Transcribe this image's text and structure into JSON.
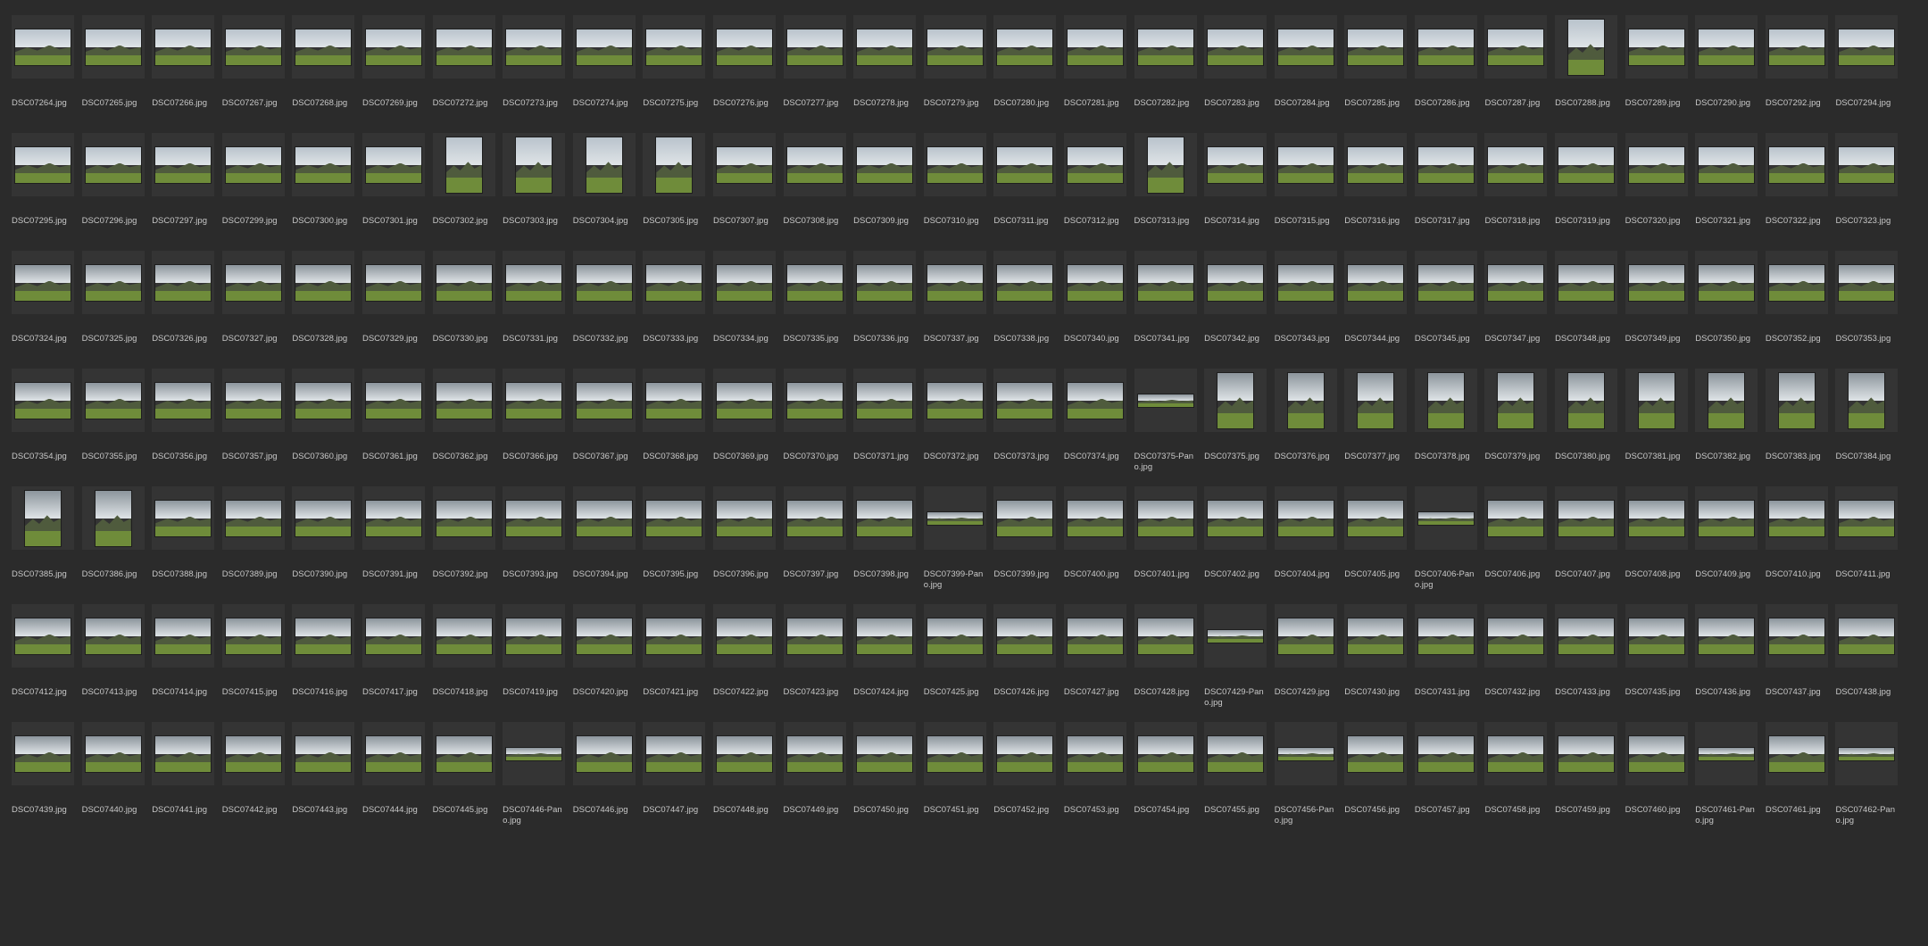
{
  "rows": [
    [
      "DSC07264.jpg",
      "DSC07265.jpg",
      "DSC07266.jpg",
      "DSC07267.jpg",
      "DSC07268.jpg",
      "DSC07269.jpg",
      "DSC07272.jpg",
      "DSC07273.jpg",
      "DSC07274.jpg",
      "DSC07275.jpg",
      "DSC07276.jpg",
      "DSC07277.jpg",
      "DSC07278.jpg",
      "DSC07279.jpg",
      "DSC07280.jpg",
      "DSC07281.jpg",
      "DSC07282.jpg",
      "DSC07283.jpg",
      "DSC07284.jpg",
      "DSC07285.jpg",
      "DSC07286.jpg",
      "DSC07287.jpg",
      "DSC07288.jpg",
      "DSC07289.jpg",
      "DSC07290.jpg",
      "DSC07292.jpg",
      "DSC07294.jpg"
    ],
    [
      "DSC07295.jpg",
      "DSC07296.jpg",
      "DSC07297.jpg",
      "DSC07299.jpg",
      "DSC07300.jpg",
      "DSC07301.jpg",
      "DSC07302.jpg",
      "DSC07303.jpg",
      "DSC07304.jpg",
      "DSC07305.jpg",
      "DSC07307.jpg",
      "DSC07308.jpg",
      "DSC07309.jpg",
      "DSC07310.jpg",
      "DSC07311.jpg",
      "DSC07312.jpg",
      "DSC07313.jpg",
      "DSC07314.jpg",
      "DSC07315.jpg",
      "DSC07316.jpg",
      "DSC07317.jpg",
      "DSC07318.jpg",
      "DSC07319.jpg",
      "DSC07320.jpg",
      "DSC07321.jpg",
      "DSC07322.jpg",
      "DSC07323.jpg"
    ],
    [
      "DSC07324.jpg",
      "DSC07325.jpg",
      "DSC07326.jpg",
      "DSC07327.jpg",
      "DSC07328.jpg",
      "DSC07329.jpg",
      "DSC07330.jpg",
      "DSC07331.jpg",
      "DSC07332.jpg",
      "DSC07333.jpg",
      "DSC07334.jpg",
      "DSC07335.jpg",
      "DSC07336.jpg",
      "DSC07337.jpg",
      "DSC07338.jpg",
      "DSC07340.jpg",
      "DSC07341.jpg",
      "DSC07342.jpg",
      "DSC07343.jpg",
      "DSC07344.jpg",
      "DSC07345.jpg",
      "DSC07347.jpg",
      "DSC07348.jpg",
      "DSC07349.jpg",
      "DSC07350.jpg",
      "DSC07352.jpg",
      "DSC07353.jpg"
    ],
    [
      "DSC07354.jpg",
      "DSC07355.jpg",
      "DSC07356.jpg",
      "DSC07357.jpg",
      "DSC07360.jpg",
      "DSC07361.jpg",
      "DSC07362.jpg",
      "DSC07366.jpg",
      "DSC07367.jpg",
      "DSC07368.jpg",
      "DSC07369.jpg",
      "DSC07370.jpg",
      "DSC07371.jpg",
      "DSC07372.jpg",
      "DSC07373.jpg",
      "DSC07374.jpg",
      "DSC07375-Pano.jpg",
      "DSC07375.jpg",
      "DSC07376.jpg",
      "DSC07377.jpg",
      "DSC07378.jpg",
      "DSC07379.jpg",
      "DSC07380.jpg",
      "DSC07381.jpg",
      "DSC07382.jpg",
      "DSC07383.jpg",
      "DSC07384.jpg"
    ],
    [
      "DSC07385.jpg",
      "DSC07386.jpg",
      "DSC07388.jpg",
      "DSC07389.jpg",
      "DSC07390.jpg",
      "DSC07391.jpg",
      "DSC07392.jpg",
      "DSC07393.jpg",
      "DSC07394.jpg",
      "DSC07395.jpg",
      "DSC07396.jpg",
      "DSC07397.jpg",
      "DSC07398.jpg",
      "DSC07399-Pano.jpg",
      "DSC07399.jpg",
      "DSC07400.jpg",
      "DSC07401.jpg",
      "DSC07402.jpg",
      "DSC07404.jpg",
      "DSC07405.jpg",
      "DSC07406-Pano.jpg",
      "DSC07406.jpg",
      "DSC07407.jpg",
      "DSC07408.jpg",
      "DSC07409.jpg",
      "DSC07410.jpg",
      "DSC07411.jpg"
    ],
    [
      "DSC07412.jpg",
      "DSC07413.jpg",
      "DSC07414.jpg",
      "DSC07415.jpg",
      "DSC07416.jpg",
      "DSC07417.jpg",
      "DSC07418.jpg",
      "DSC07419.jpg",
      "DSC07420.jpg",
      "DSC07421.jpg",
      "DSC07422.jpg",
      "DSC07423.jpg",
      "DSC07424.jpg",
      "DSC07425.jpg",
      "DSC07426.jpg",
      "DSC07427.jpg",
      "DSC07428.jpg",
      "DSC07429-Pano.jpg",
      "DSC07429.jpg",
      "DSC07430.jpg",
      "DSC07431.jpg",
      "DSC07432.jpg",
      "DSC07433.jpg",
      "DSC07435.jpg",
      "DSC07436.jpg",
      "DSC07437.jpg",
      "DSC07438.jpg"
    ],
    [
      "DSC07439.jpg",
      "DSC07440.jpg",
      "DSC07441.jpg",
      "DSC07442.jpg",
      "DSC07443.jpg",
      "DSC07444.jpg",
      "DSC07445.jpg",
      "DSC07446-Pano.jpg",
      "DSC07446.jpg",
      "DSC07447.jpg",
      "DSC07448.jpg",
      "DSC07449.jpg",
      "DSC07450.jpg",
      "DSC07451.jpg",
      "DSC07452.jpg",
      "DSC07453.jpg",
      "DSC07454.jpg",
      "DSC07455.jpg",
      "DSC07456-Pano.jpg",
      "DSC07456.jpg",
      "DSC07457.jpg",
      "DSC07458.jpg",
      "DSC07459.jpg",
      "DSC07460.jpg",
      "DSC07461-Pano.jpg",
      "DSC07461.jpg",
      "DSC07462-Pano.jpg"
    ]
  ],
  "portrait": [
    "DSC07288.jpg",
    "DSC07302.jpg",
    "DSC07303.jpg",
    "DSC07304.jpg",
    "DSC07305.jpg",
    "DSC07313.jpg",
    "DSC07375.jpg",
    "DSC07376.jpg",
    "DSC07377.jpg",
    "DSC07378.jpg",
    "DSC07379.jpg",
    "DSC07380.jpg",
    "DSC07381.jpg",
    "DSC07382.jpg",
    "DSC07383.jpg",
    "DSC07384.jpg",
    "DSC07385.jpg",
    "DSC07386.jpg"
  ],
  "colors": {
    "background": "#2b2b2b",
    "thumb_frame": "#343434",
    "filename_text": "#c8c8c8",
    "sky": "#b9c3cc",
    "sky_overcast": "#8c959c",
    "hill": "#4f5b3d",
    "field": "#6f8c3a"
  }
}
